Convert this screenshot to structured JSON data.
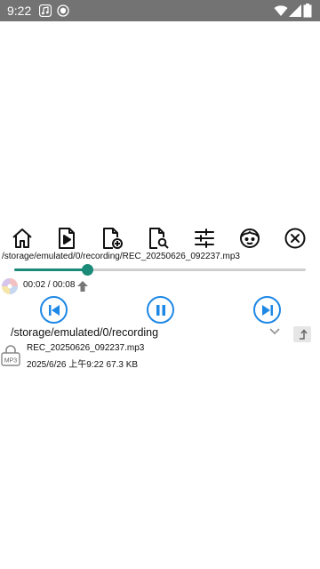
{
  "status_bar": {
    "time": "9:22",
    "left_icons": [
      "music-note-icon",
      "shield-circle-icon"
    ],
    "right_icons": [
      "wifi-icon",
      "signal-icon",
      "battery-icon"
    ]
  },
  "toolbar": {
    "buttons": [
      {
        "name": "home",
        "icon": "home-icon"
      },
      {
        "name": "play-file",
        "icon": "play-file-icon"
      },
      {
        "name": "add-file",
        "icon": "add-file-icon"
      },
      {
        "name": "search-file",
        "icon": "search-file-icon"
      },
      {
        "name": "settings",
        "icon": "sliders-icon"
      },
      {
        "name": "face",
        "icon": "face-icon"
      },
      {
        "name": "close",
        "icon": "close-circle-icon"
      }
    ]
  },
  "player": {
    "file_path": "/storage/emulated/0/recording/REC_20250626_092237.mp3",
    "progress_fraction": 0.25,
    "time_readout": "00:02 / 00:08",
    "accent_color": "#1b8a78",
    "button_color": "#1e88e5"
  },
  "controls": {
    "previous_icon": "skip-previous-icon",
    "pause_icon": "pause-icon",
    "next_icon": "skip-next-icon"
  },
  "browser": {
    "directory": "/storage/emulated/0/recording",
    "files": [
      {
        "name": "REC_20250626_092237.mp3",
        "meta": "2025/6/26 上午9:22 67.3 KB",
        "icon_label": "MP3"
      }
    ]
  }
}
